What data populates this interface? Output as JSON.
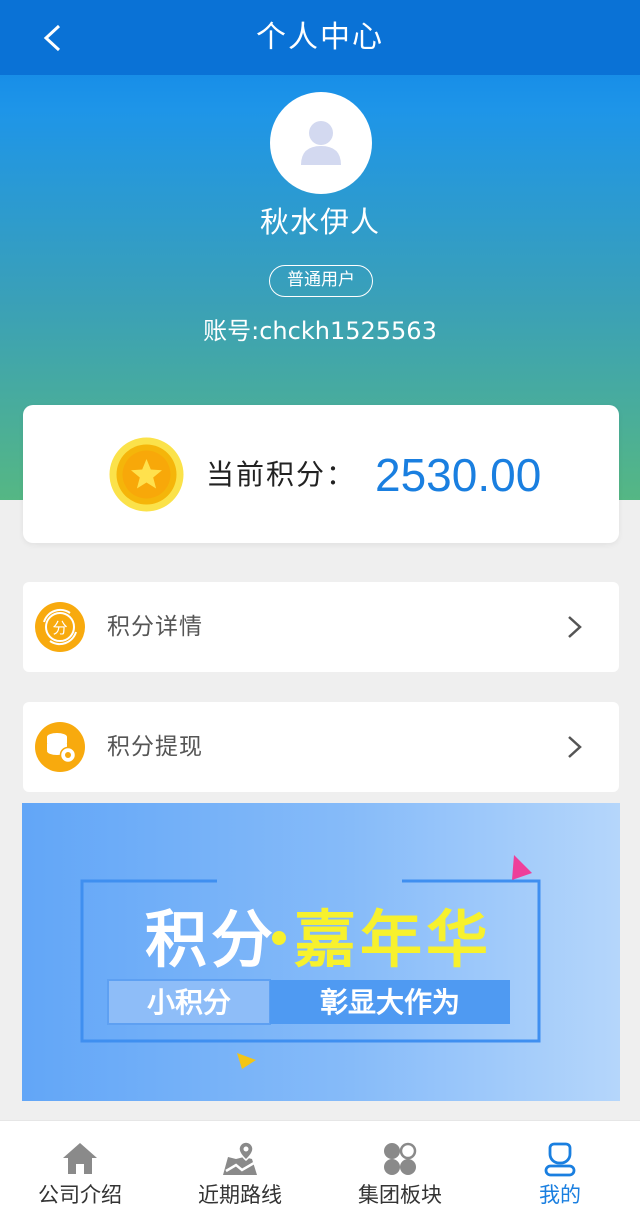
{
  "header": {
    "title": "个人中心"
  },
  "profile": {
    "name": "秋水伊人",
    "role": "普通用户",
    "account": "账号:chckh1525563"
  },
  "points": {
    "label": "当前积分：",
    "value": "2530.00"
  },
  "menu": [
    {
      "label": "积分详情",
      "icon": "points-detail-icon"
    },
    {
      "label": "积分提现",
      "icon": "points-withdraw-icon"
    }
  ],
  "banner": {
    "title_part1": "积分",
    "title_part2": "嘉年华",
    "subtitle_left": "小积分",
    "subtitle_right": "彰显大作为"
  },
  "tabs": [
    {
      "label": "公司介绍",
      "icon": "home-icon",
      "active": false
    },
    {
      "label": "近期路线",
      "icon": "map-route-icon",
      "active": false
    },
    {
      "label": "集团板块",
      "icon": "grid-icon",
      "active": false
    },
    {
      "label": "我的",
      "icon": "user-icon",
      "active": true
    }
  ],
  "colors": {
    "accent": "#1a7fe0",
    "topbar": "#0a72d6",
    "coin": "#f5b50a",
    "banner_highlight": "#f7f12d"
  }
}
